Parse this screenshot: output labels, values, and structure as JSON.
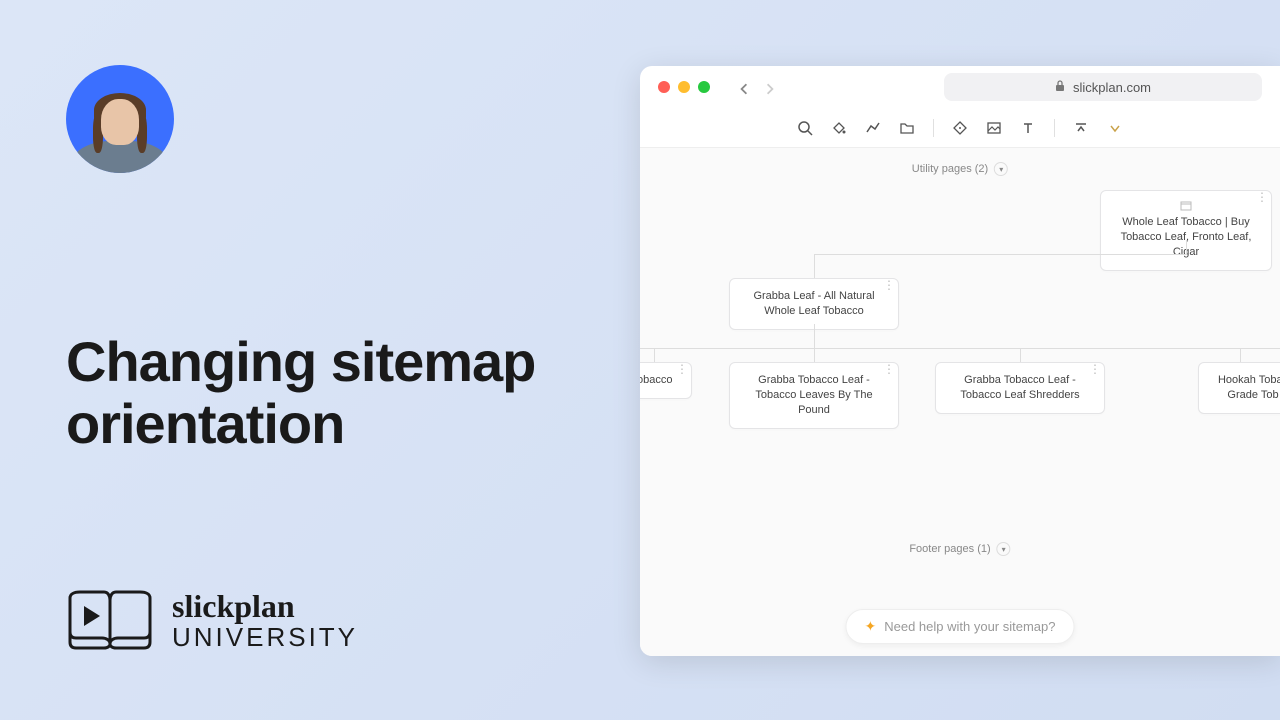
{
  "heading": "Changing sitemap orientation",
  "logo": {
    "script": "slickplan",
    "uni": "UNIVERSITY"
  },
  "browser": {
    "url": "slickplan.com",
    "utility_label": "Utility pages (2)",
    "footer_label": "Footer pages (1)",
    "help": "Need help with your sitemap?"
  },
  "nodes": {
    "root": "Whole Leaf Tobacco | Buy Tobacco Leaf, Fronto Leaf, Cigar",
    "mid": "Grabba Leaf - All Natural Whole Leaf Tobacco",
    "c1": "Tobacco",
    "c2": "Grabba Tobacco Leaf - Tobacco Leaves By The Pound",
    "c3": "Grabba Tobacco Leaf - Tobacco Leaf Shredders",
    "c4": "Hookah Tobac Grade Tob"
  }
}
